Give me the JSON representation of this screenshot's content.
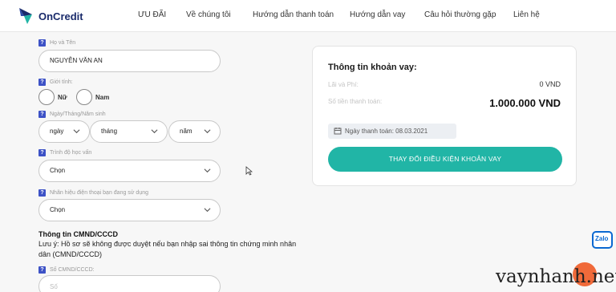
{
  "brand": {
    "name": "OnCredit"
  },
  "nav": [
    {
      "label": "ƯU ĐÃI"
    },
    {
      "label": "Về chúng tôi"
    },
    {
      "label": "Hướng dẫn thanh toán"
    },
    {
      "label": "Hướng dẫn vay"
    },
    {
      "label": "Câu hỏi thường gặp"
    },
    {
      "label": "Liên hệ"
    }
  ],
  "form": {
    "fullname": {
      "label": "Họ và Tên",
      "value": "NGUYỄN VĂN AN"
    },
    "gender": {
      "label": "Giới tính:",
      "options": [
        "Nữ",
        "Nam"
      ]
    },
    "dob": {
      "label": "Ngày/Tháng/Năm sinh",
      "day": "ngày",
      "month": "tháng",
      "year": "năm"
    },
    "education": {
      "label": "Trình độ học vấn",
      "value": "Chọn"
    },
    "phone_brand": {
      "label": "Nhãn hiệu điện thoại bạn đang sử dụng",
      "value": "Chọn"
    },
    "id_section": {
      "title": "Thông tin CMND/CCCD",
      "note_line1": "Lưu ý: Hồ sơ sẽ không được duyệt nếu bạn nhập sai thông tin chứng minh nhân",
      "note_line2": "dân (CMND/CCCD)",
      "id_label": "Số CMND/CCCD:",
      "id_placeholder": "Số"
    },
    "help_badge": "?"
  },
  "loan": {
    "title": "Thông tin khoản vay:",
    "fee_label": "Lãi và Phí:",
    "fee_value": "0 VND",
    "total_label": "Số tiền thanh toán:",
    "total_value": "1.000.000 VND",
    "pay_date": "Ngày thanh toán: 08.03.2021",
    "change_button": "THAY ĐỔI ĐIỀU KIỆN KHOẢN VAY"
  },
  "zalo": {
    "label": "Zalo"
  },
  "watermark": "vaynhanh.net",
  "colors": {
    "accent": "#21b5a6",
    "badge": "#3d52c6",
    "brand": "#1a2b6b"
  }
}
